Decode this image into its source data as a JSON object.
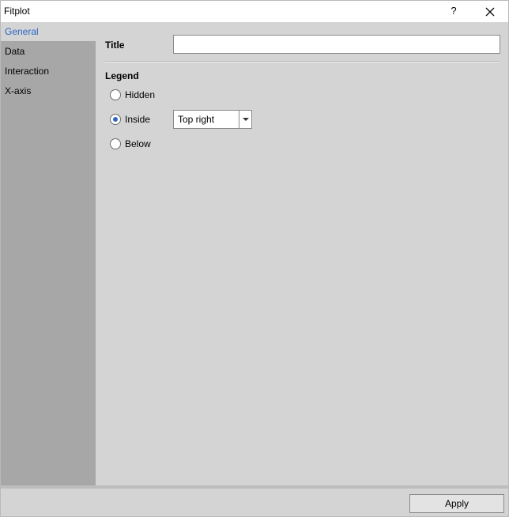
{
  "window": {
    "title": "Fitplot",
    "help_label": "?",
    "close_icon": "close-icon"
  },
  "sidebar": {
    "items": [
      {
        "label": "General",
        "active": true
      },
      {
        "label": "Data",
        "active": false
      },
      {
        "label": "Interaction",
        "active": false
      },
      {
        "label": "X-axis",
        "active": false
      }
    ]
  },
  "general": {
    "title_label": "Title",
    "title_value": "",
    "legend_heading": "Legend",
    "legend_options": [
      {
        "label": "Hidden",
        "selected": false
      },
      {
        "label": "Inside",
        "selected": true
      },
      {
        "label": "Below",
        "selected": false
      }
    ],
    "legend_position": "Top right"
  },
  "footer": {
    "apply_label": "Apply"
  },
  "colors": {
    "accent": "#2f66c4",
    "panel": "#d4d4d4",
    "sidebar": "#a7a7a7"
  }
}
